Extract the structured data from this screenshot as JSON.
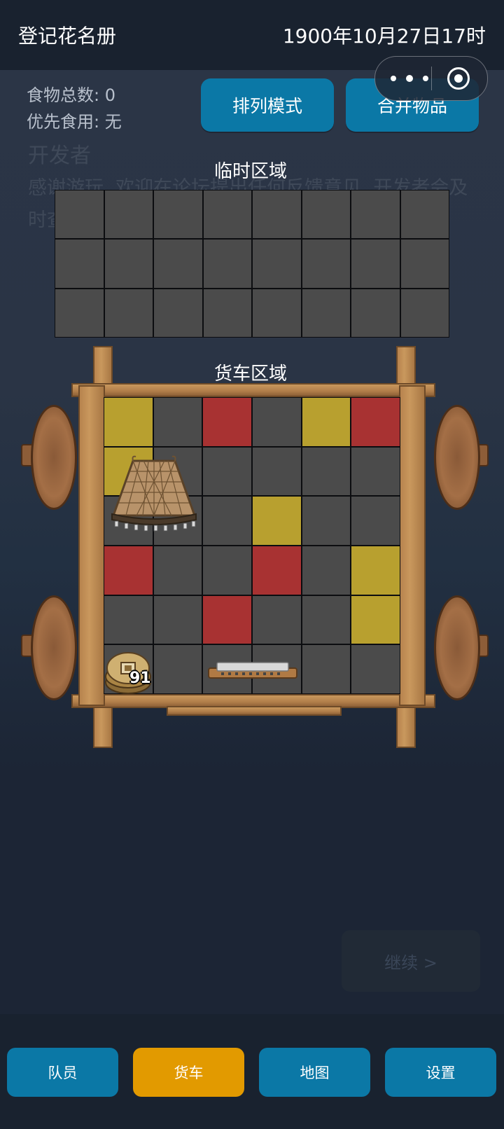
{
  "header": {
    "title": "登记花名册",
    "datetime": "1900年10月27日17时"
  },
  "background_text": {
    "heading": "开发者",
    "body": "感谢游玩, 欢迎在论坛提出任何反馈意见, 开发者会及时查看和修复"
  },
  "food": {
    "total": "食物总数: 0",
    "priority": "优先食用: 无"
  },
  "buttons": {
    "arrange": "排列模式",
    "merge": "合并物品",
    "continue": "继续 >"
  },
  "temp_zone": {
    "title": "临时区域",
    "rows": 3,
    "cols": 8
  },
  "cart_zone": {
    "title": "货车区域",
    "rows": 6,
    "cols": 6,
    "cells": [
      [
        "yellow",
        "gray",
        "red",
        "gray",
        "yellow",
        "red"
      ],
      [
        "yellow",
        "gray",
        "gray",
        "gray",
        "gray",
        "gray"
      ],
      [
        "gray",
        "gray",
        "gray",
        "yellow",
        "gray",
        "gray"
      ],
      [
        "red",
        "gray",
        "gray",
        "red",
        "gray",
        "yellow"
      ],
      [
        "gray",
        "gray",
        "red",
        "gray",
        "gray",
        "yellow"
      ],
      [
        "gray",
        "gray",
        "gray",
        "gray",
        "gray",
        "gray"
      ]
    ],
    "items": [
      {
        "name": "lamp-net-icon",
        "row": 2,
        "col": 1,
        "rows": 2,
        "cols": 2
      },
      {
        "name": "coin-stack-icon",
        "row": 6,
        "col": 1,
        "rows": 1,
        "cols": 1,
        "count": "91"
      },
      {
        "name": "harmonica-icon",
        "row": 6,
        "col": 3,
        "rows": 1,
        "cols": 2
      }
    ]
  },
  "colors": {
    "yellow": "#b8a02f",
    "red": "#a83232",
    "gray": "#4b4b4b",
    "nav_active": "#e29a00",
    "button": "#0b78a6"
  },
  "nav": {
    "members": "队员",
    "cart": "货车",
    "map": "地图",
    "settings": "设置"
  }
}
